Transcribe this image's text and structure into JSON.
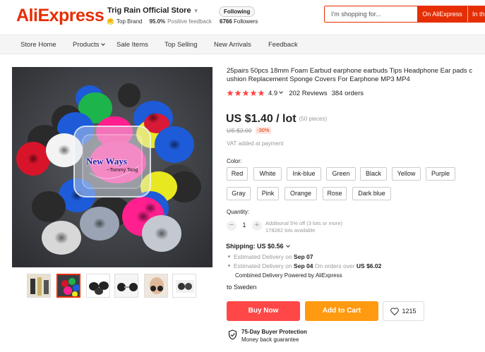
{
  "header": {
    "logo": "AliExpress",
    "store_name": "Trig Rain Official Store",
    "top_brand": "Top Brand",
    "positive_pct": "95.0%",
    "positive_label": "Positive feedback",
    "follow_label": "Following",
    "followers_count": "6766",
    "followers_label": "Followers",
    "search_placeholder": "I'm shopping for...",
    "search_btn": "On AliExpress",
    "search_btn2": "In this store"
  },
  "nav": {
    "items": [
      "Store Home",
      "Products",
      "Sale Items",
      "Top Selling",
      "New Arrivals",
      "Feedback"
    ]
  },
  "gallery": {
    "watermark": "New Ways",
    "watermark_sub": "--Tommy Tong"
  },
  "product": {
    "title": "25pairs 50pcs 18mm Foam Earbud earphone earbuds Tips Headphone Ear pads cushion Replacement Sponge Covers For Earphone MP3 MP4",
    "rating": "4.9",
    "rating_value": 4.9,
    "reviews": "202 Reviews",
    "orders": "384 orders",
    "price": "US $1.40 / lot",
    "pieces": "(50 pieces)",
    "old_price": "US $2.00",
    "discount": "-30%",
    "vat": "VAT added at payment",
    "color_label": "Color:",
    "colors": [
      "Red",
      "White",
      "Ink-blue",
      "Green",
      "Black",
      "Yellow",
      "Purple",
      "Gray",
      "Pink",
      "Orange",
      "Rose",
      "Dark blue"
    ],
    "quantity_label": "Quantity:",
    "quantity": "1",
    "qty_note_1": "Additional 5% off (3 lots or more)",
    "qty_note_2": "178282 lots available",
    "shipping_label": "Shipping: US $0.56",
    "delivery_1_pre": "Estimated Delivery on",
    "delivery_1_date": "Sep 07",
    "delivery_2_pre": "Estimated Delivery on",
    "delivery_2_date": "Sep 04",
    "delivery_2_mid": "On orders over",
    "delivery_2_amount": "US $6.02",
    "combined": "Combined Delivery Powered by AliExpress",
    "to_country": "to Sweden",
    "buy_now": "Buy Now",
    "add_to_cart": "Add to Cart",
    "wishlist_count": "1215",
    "protection_title": "75-Day Buyer Protection",
    "protection_sub": "Money back guarantee"
  },
  "colors": {
    "brand": "#e62e04",
    "buy": "#ff4747",
    "cart": "#ff9a11",
    "star": "#ff4747"
  },
  "icons": {
    "brand_badge": "check-badge-icon",
    "wishlist": "heart-icon",
    "protection": "shield-check-icon"
  }
}
